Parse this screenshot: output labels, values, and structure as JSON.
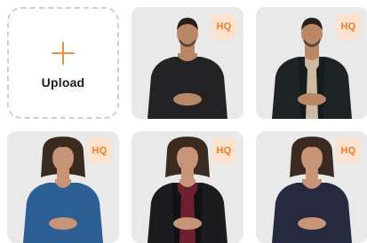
{
  "upload": {
    "label": "Upload",
    "icon": "plus-icon",
    "accent": "#f08c3a"
  },
  "badge_colors": {
    "background": "#fde3cf",
    "text": "#f07d2a"
  },
  "avatars": [
    {
      "badge": "HQ",
      "outfit": "black t-shirt",
      "top_color": "#232325",
      "skin": "#b98765",
      "hair": "#2a1f1a",
      "inner_color": "#232325"
    },
    {
      "badge": "HQ",
      "outfit": "dark overshirt over beige t-shirt",
      "top_color": "#1e2426",
      "skin": "#b98765",
      "hair": "#2a1f1a",
      "inner_color": "#cdbaa2"
    },
    {
      "badge": "HQ",
      "outfit": "blue blouse",
      "top_color": "#2d5f95",
      "skin": "#c89477",
      "hair": "#3b2a20",
      "inner_color": "#2d5f95"
    },
    {
      "badge": "HQ",
      "outfit": "black blazer over maroon top",
      "top_color": "#1c1c1e",
      "skin": "#c89477",
      "hair": "#3b2a20",
      "inner_color": "#6e2030"
    },
    {
      "badge": "HQ",
      "outfit": "navy top",
      "top_color": "#262a3e",
      "skin": "#c89477",
      "hair": "#3b2a20",
      "inner_color": "#262a3e"
    }
  ]
}
